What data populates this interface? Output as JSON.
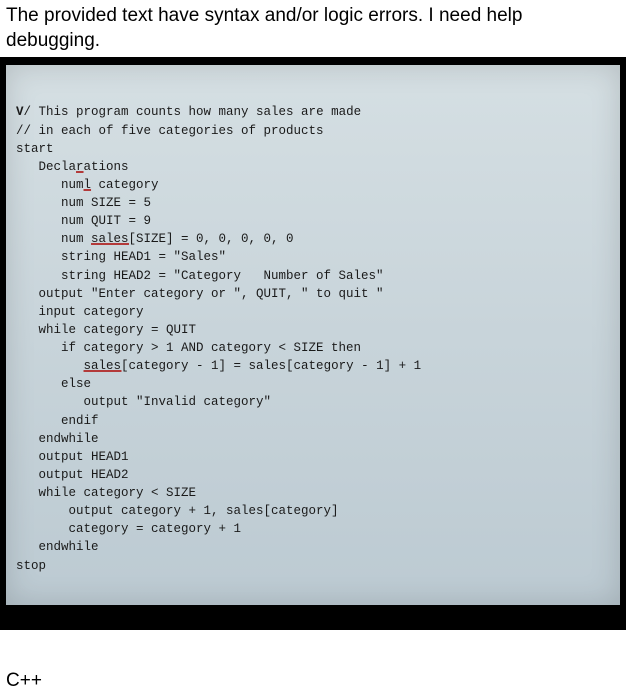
{
  "header": {
    "text": "The provided text have syntax and/or logic errors. I need help debugging."
  },
  "code": {
    "l1a": "V",
    "l1b": "/ This program counts how many sales are made",
    "l2": "// in each of five categories of products",
    "l3": "start",
    "l4": "   Declarations",
    "l4u": "r",
    "l5a": "      num",
    "l5u": "l",
    "l5b": " category",
    "l6": "      num SIZE = 5",
    "l7": "      num QUIT = 9",
    "l8a": "      num ",
    "l8u": "sales[",
    "l8b": "SIZE] = 0, 0, 0, 0, 0",
    "l9": "      string HEAD1 = \"Sales\"",
    "l10": "      string HEAD2 = \"Category   Number of Sales\"",
    "l11": "   output \"Enter category or \", QUIT, \" to quit \"",
    "l12": "   input category",
    "l13": "   while category = QUIT",
    "l14": "      if category > 1 AND category < SIZE then",
    "l15a": "         ",
    "l15u": "sales[",
    "l15b": "category - 1] = sales[category - 1] + 1",
    "l16": "      else",
    "l17": "         output \"Invalid category\"",
    "l18": "      endif",
    "l19": "   endwhile",
    "l20": "   output HEAD1",
    "l21": "   output HEAD2",
    "l22": "   while category < SIZE",
    "l23": "       output category + 1, sales[category]",
    "l24": "       category = category + 1",
    "l25": "   endwhile",
    "l26": "stop"
  },
  "footer": {
    "text": "C++"
  }
}
